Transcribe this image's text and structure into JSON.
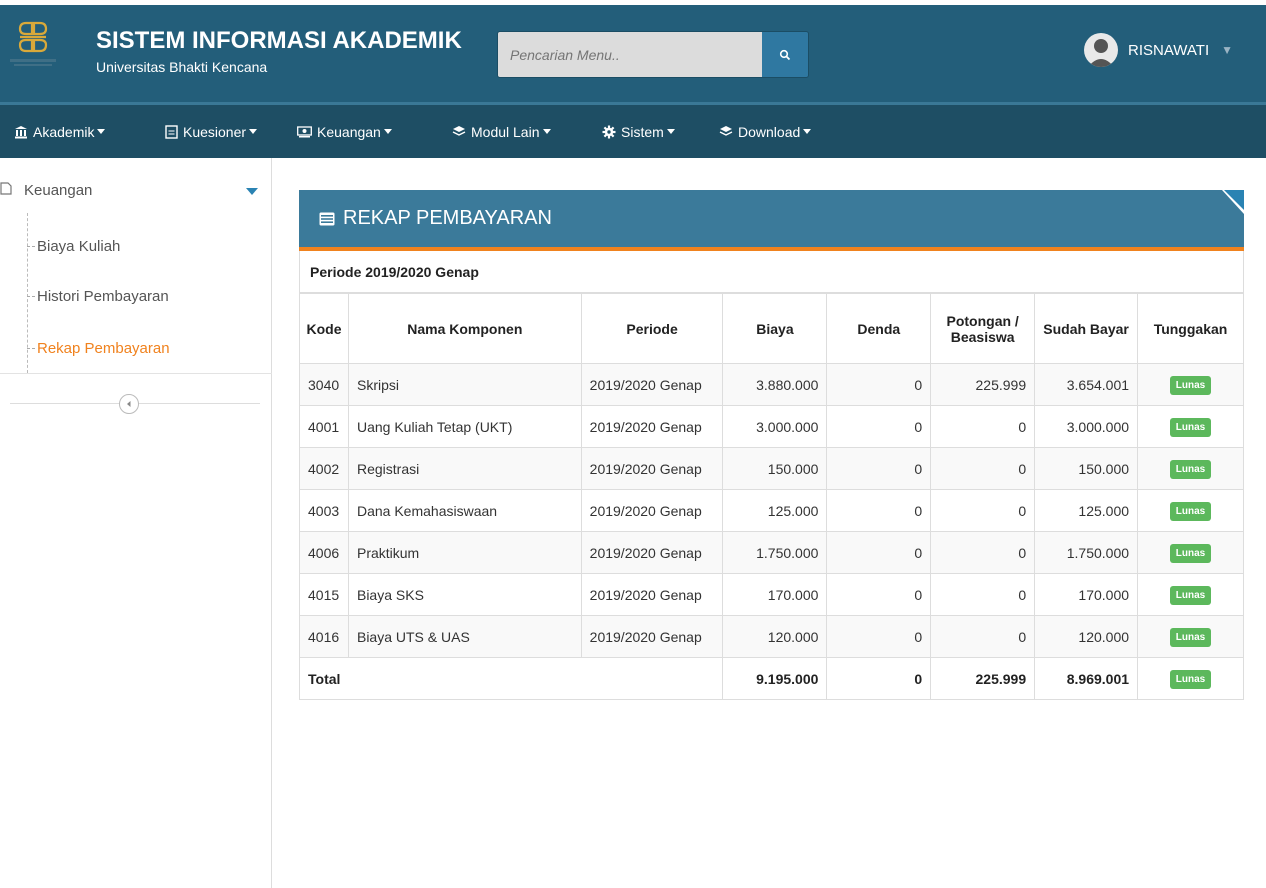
{
  "app": {
    "title": "SISTEM INFORMASI AKADEMIK",
    "subtitle": "Universitas Bhakti Kencana"
  },
  "search": {
    "placeholder": "Pencarian Menu.."
  },
  "user": {
    "name": "RISNAWATI"
  },
  "nav": {
    "items": [
      {
        "label": "Akademik",
        "icon": "bank-icon"
      },
      {
        "label": "Kuesioner",
        "icon": "file-icon"
      },
      {
        "label": "Keuangan",
        "icon": "money-icon"
      },
      {
        "label": "Modul Lain",
        "icon": "layers-icon"
      },
      {
        "label": "Sistem",
        "icon": "gear-icon"
      },
      {
        "label": "Download",
        "icon": "layers-icon"
      }
    ]
  },
  "sidebar": {
    "section": "Keuangan",
    "items": [
      {
        "label": "Biaya Kuliah",
        "active": false
      },
      {
        "label": "Histori Pembayaran",
        "active": false
      },
      {
        "label": "Rekap Pembayaran",
        "active": true
      }
    ]
  },
  "panel": {
    "title": "REKAP PEMBAYARAN",
    "periode": "Periode 2019/2020 Genap",
    "columns": [
      "Kode",
      "Nama Komponen",
      "Periode",
      "Biaya",
      "Denda",
      "Potongan / Beasiswa",
      "Sudah Bayar",
      "Tunggakan"
    ],
    "rows": [
      {
        "kode": "3040",
        "nama": "Skripsi",
        "periode": "2019/2020 Genap",
        "biaya": "3.880.000",
        "denda": "0",
        "potongan": "225.999",
        "sudah": "3.654.001",
        "status": "Lunas"
      },
      {
        "kode": "4001",
        "nama": "Uang Kuliah Tetap (UKT)",
        "periode": "2019/2020 Genap",
        "biaya": "3.000.000",
        "denda": "0",
        "potongan": "0",
        "sudah": "3.000.000",
        "status": "Lunas"
      },
      {
        "kode": "4002",
        "nama": "Registrasi",
        "periode": "2019/2020 Genap",
        "biaya": "150.000",
        "denda": "0",
        "potongan": "0",
        "sudah": "150.000",
        "status": "Lunas"
      },
      {
        "kode": "4003",
        "nama": "Dana Kemahasiswaan",
        "periode": "2019/2020 Genap",
        "biaya": "125.000",
        "denda": "0",
        "potongan": "0",
        "sudah": "125.000",
        "status": "Lunas"
      },
      {
        "kode": "4006",
        "nama": "Praktikum",
        "periode": "2019/2020 Genap",
        "biaya": "1.750.000",
        "denda": "0",
        "potongan": "0",
        "sudah": "1.750.000",
        "status": "Lunas"
      },
      {
        "kode": "4015",
        "nama": "Biaya SKS",
        "periode": "2019/2020 Genap",
        "biaya": "170.000",
        "denda": "0",
        "potongan": "0",
        "sudah": "170.000",
        "status": "Lunas"
      },
      {
        "kode": "4016",
        "nama": "Biaya UTS & UAS",
        "periode": "2019/2020 Genap",
        "biaya": "120.000",
        "denda": "0",
        "potongan": "0",
        "sudah": "120.000",
        "status": "Lunas"
      }
    ],
    "total": {
      "label": "Total",
      "biaya": "9.195.000",
      "denda": "0",
      "potongan": "225.999",
      "sudah": "8.969.001",
      "status": "Lunas"
    }
  },
  "colors": {
    "header": "#235e7a",
    "navbar": "#1e4e64",
    "accent": "#f0821e",
    "panel_header": "#3b7a9a",
    "badge": "#5cb85c"
  }
}
